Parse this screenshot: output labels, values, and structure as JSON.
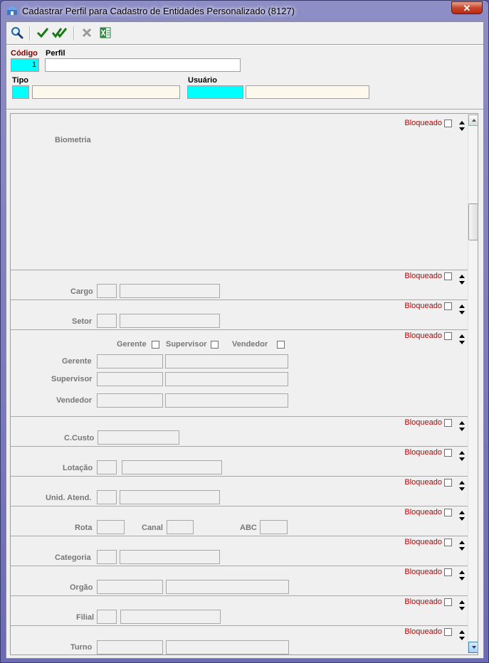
{
  "window": {
    "title": "Cadastrar Perfil para Cadastro de Entidades Personalizado (8127)",
    "close_label": "✕"
  },
  "toolbar": {
    "buttons": [
      {
        "name": "search",
        "icon": "magnifier-icon"
      },
      {
        "name": "confirm",
        "icon": "checkmark-icon"
      },
      {
        "name": "confirm-all",
        "icon": "double-checkmark-icon"
      },
      {
        "name": "cancel",
        "icon": "x-icon"
      },
      {
        "name": "excel",
        "icon": "excel-icon"
      }
    ]
  },
  "header": {
    "codigo_label": "Código",
    "codigo_value": "1",
    "perfil_label": "Perfil",
    "perfil_value": "",
    "tipo_label": "Tipo",
    "usuario_label": "Usuário"
  },
  "sections": {
    "bloqueado_label": "Bloqueado",
    "biometria_label": "Biometria",
    "cargo_label": "Cargo",
    "setor_label": "Setor",
    "gerente_check_label": "Gerente",
    "supervisor_check_label": "Supervisor",
    "vendedor_check_label": "Vendedor",
    "gerente_label": "Gerente",
    "supervisor_label": "Supervisor",
    "vendedor_label": "Vendedor",
    "ccusto_label": "C.Custo",
    "lotacao_label": "Lotação",
    "unid_atend_label": "Unid. Atend.",
    "rota_label": "Rota",
    "canal_label": "Canal",
    "abc_label": "ABC",
    "categoria_label": "Categoria",
    "orgao_label": "Orgão",
    "filial_label": "Filial",
    "turno_label": "Turno"
  },
  "colors": {
    "accent_cyan": "#00ffff",
    "bloqueado_red": "#c00000",
    "codigo_label_red": "#7b0000"
  }
}
